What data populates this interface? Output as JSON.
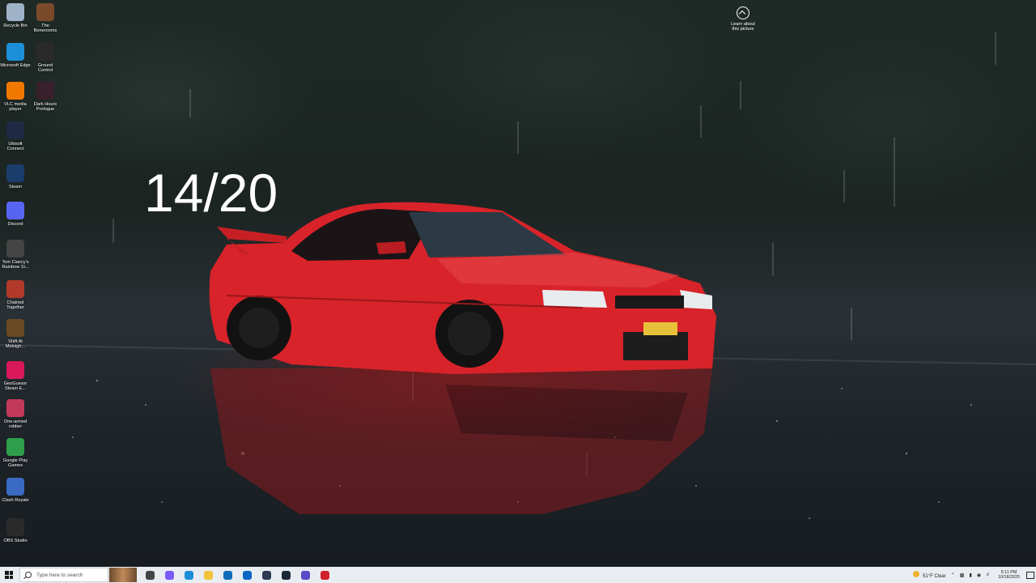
{
  "overlay": {
    "counter_text": "14/20"
  },
  "spotlight": {
    "label": "Learn about this picture"
  },
  "desktop_icons": [
    {
      "label": "Recycle Bin",
      "icon": "recycle-bin-icon",
      "color": "#9fb3c8"
    },
    {
      "label": "The Bonerooms",
      "icon": "bonerooms-icon",
      "color": "#7a4a2a"
    },
    {
      "label": "Microsoft Edge",
      "icon": "edge-icon",
      "color": "#1d8fd8"
    },
    {
      "label": "Ground Control",
      "icon": "ground-control-icon",
      "color": "#2a2a2a"
    },
    {
      "label": "VLC media player",
      "icon": "vlc-icon",
      "color": "#f07800"
    },
    {
      "label": "Dark Hours Prologue",
      "icon": "dark-hours-icon",
      "color": "#3a1f2c"
    },
    {
      "label": "Ubisoft Connect",
      "icon": "ubisoft-icon",
      "color": "#1e2a44"
    },
    {
      "label": "Steam",
      "icon": "steam-icon",
      "color": "#1b3d6b"
    },
    {
      "label": "Discord",
      "icon": "discord-icon",
      "color": "#5865f2"
    },
    {
      "label": "Tom Clancy's Rainbow Si...",
      "icon": "rainbow-six-icon",
      "color": "#444444"
    },
    {
      "label": "Chained Together",
      "icon": "chained-together-icon",
      "color": "#b23a2a"
    },
    {
      "label": "Shift At Midnigh...",
      "icon": "shift-at-midnight-icon",
      "color": "#6a4a22"
    },
    {
      "label": "GeoGuessr Steam E...",
      "icon": "geoguessr-icon",
      "color": "#d9185a"
    },
    {
      "label": "One-armed robber",
      "icon": "one-armed-robber-icon",
      "color": "#c23a5a"
    },
    {
      "label": "Google Play Games",
      "icon": "google-play-games-icon",
      "color": "#2e9e4a"
    },
    {
      "label": "Clash Royale",
      "icon": "clash-royale-icon",
      "color": "#3a6ac2"
    },
    {
      "label": "OBS Studio",
      "icon": "obs-icon",
      "color": "#2b2b2b"
    }
  ],
  "taskbar": {
    "search_placeholder": "Type here to search",
    "apps": [
      {
        "name": "task-view-icon",
        "color": "#444444"
      },
      {
        "name": "copilot-icon",
        "color": "#7a5af8"
      },
      {
        "name": "edge-taskbar-icon",
        "color": "#1d8fd8"
      },
      {
        "name": "file-explorer-icon",
        "color": "#f2c23a"
      },
      {
        "name": "store-icon",
        "color": "#0f6cbd"
      },
      {
        "name": "outlook-icon",
        "color": "#0a66c2"
      },
      {
        "name": "ubisoft-taskbar-icon",
        "color": "#2b3a55"
      },
      {
        "name": "steam-taskbar-icon",
        "color": "#1b2838"
      },
      {
        "name": "obs-taskbar-icon",
        "color": "#5a4ac8"
      },
      {
        "name": "recorder-taskbar-icon",
        "color": "#d0202a"
      }
    ],
    "weather": "51°F  Clear",
    "time": "9:11 PM",
    "date": "10/18/2025"
  }
}
